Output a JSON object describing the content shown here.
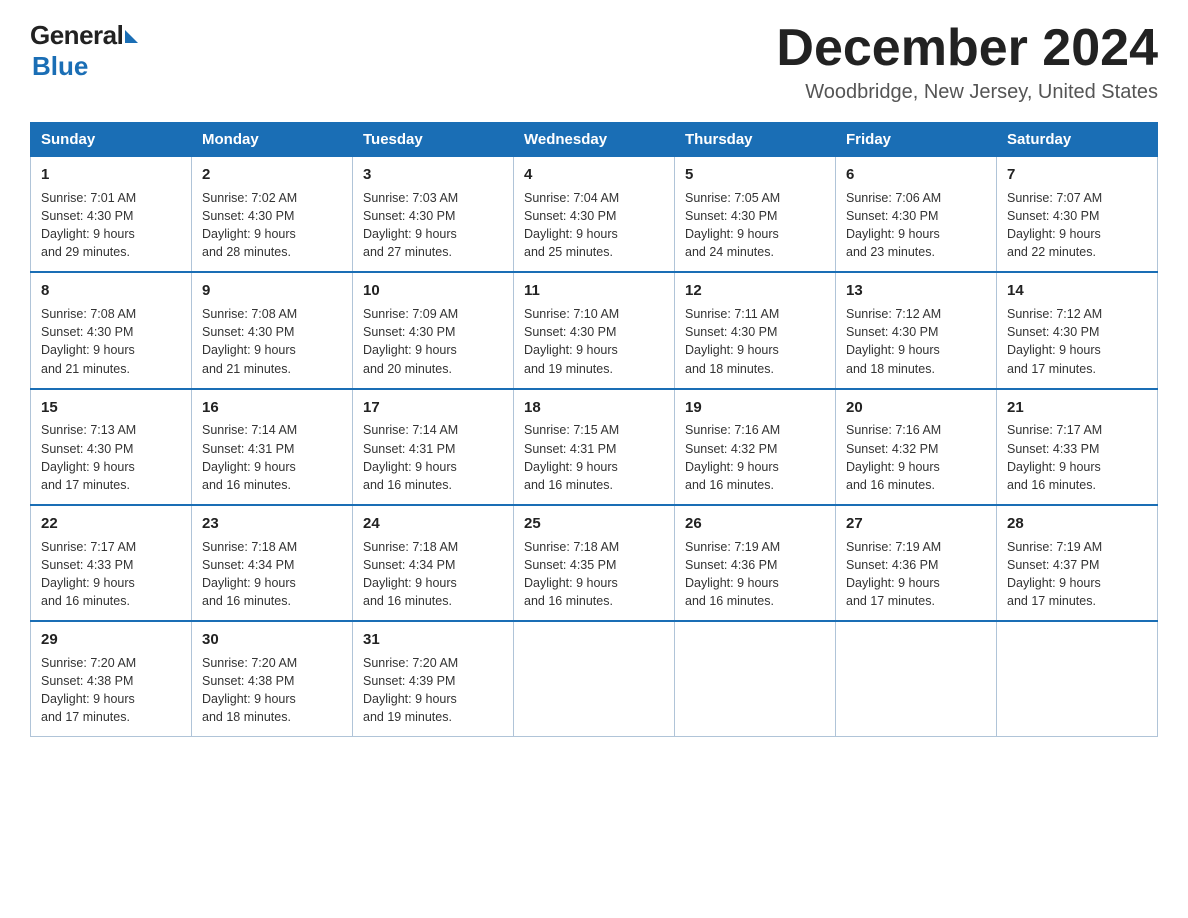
{
  "header": {
    "logo_general": "General",
    "logo_blue": "Blue",
    "month_title": "December 2024",
    "location": "Woodbridge, New Jersey, United States"
  },
  "days_of_week": [
    "Sunday",
    "Monday",
    "Tuesday",
    "Wednesday",
    "Thursday",
    "Friday",
    "Saturday"
  ],
  "weeks": [
    [
      {
        "day": "1",
        "sunrise": "7:01 AM",
        "sunset": "4:30 PM",
        "daylight": "9 hours and 29 minutes."
      },
      {
        "day": "2",
        "sunrise": "7:02 AM",
        "sunset": "4:30 PM",
        "daylight": "9 hours and 28 minutes."
      },
      {
        "day": "3",
        "sunrise": "7:03 AM",
        "sunset": "4:30 PM",
        "daylight": "9 hours and 27 minutes."
      },
      {
        "day": "4",
        "sunrise": "7:04 AM",
        "sunset": "4:30 PM",
        "daylight": "9 hours and 25 minutes."
      },
      {
        "day": "5",
        "sunrise": "7:05 AM",
        "sunset": "4:30 PM",
        "daylight": "9 hours and 24 minutes."
      },
      {
        "day": "6",
        "sunrise": "7:06 AM",
        "sunset": "4:30 PM",
        "daylight": "9 hours and 23 minutes."
      },
      {
        "day": "7",
        "sunrise": "7:07 AM",
        "sunset": "4:30 PM",
        "daylight": "9 hours and 22 minutes."
      }
    ],
    [
      {
        "day": "8",
        "sunrise": "7:08 AM",
        "sunset": "4:30 PM",
        "daylight": "9 hours and 21 minutes."
      },
      {
        "day": "9",
        "sunrise": "7:08 AM",
        "sunset": "4:30 PM",
        "daylight": "9 hours and 21 minutes."
      },
      {
        "day": "10",
        "sunrise": "7:09 AM",
        "sunset": "4:30 PM",
        "daylight": "9 hours and 20 minutes."
      },
      {
        "day": "11",
        "sunrise": "7:10 AM",
        "sunset": "4:30 PM",
        "daylight": "9 hours and 19 minutes."
      },
      {
        "day": "12",
        "sunrise": "7:11 AM",
        "sunset": "4:30 PM",
        "daylight": "9 hours and 18 minutes."
      },
      {
        "day": "13",
        "sunrise": "7:12 AM",
        "sunset": "4:30 PM",
        "daylight": "9 hours and 18 minutes."
      },
      {
        "day": "14",
        "sunrise": "7:12 AM",
        "sunset": "4:30 PM",
        "daylight": "9 hours and 17 minutes."
      }
    ],
    [
      {
        "day": "15",
        "sunrise": "7:13 AM",
        "sunset": "4:30 PM",
        "daylight": "9 hours and 17 minutes."
      },
      {
        "day": "16",
        "sunrise": "7:14 AM",
        "sunset": "4:31 PM",
        "daylight": "9 hours and 16 minutes."
      },
      {
        "day": "17",
        "sunrise": "7:14 AM",
        "sunset": "4:31 PM",
        "daylight": "9 hours and 16 minutes."
      },
      {
        "day": "18",
        "sunrise": "7:15 AM",
        "sunset": "4:31 PM",
        "daylight": "9 hours and 16 minutes."
      },
      {
        "day": "19",
        "sunrise": "7:16 AM",
        "sunset": "4:32 PM",
        "daylight": "9 hours and 16 minutes."
      },
      {
        "day": "20",
        "sunrise": "7:16 AM",
        "sunset": "4:32 PM",
        "daylight": "9 hours and 16 minutes."
      },
      {
        "day": "21",
        "sunrise": "7:17 AM",
        "sunset": "4:33 PM",
        "daylight": "9 hours and 16 minutes."
      }
    ],
    [
      {
        "day": "22",
        "sunrise": "7:17 AM",
        "sunset": "4:33 PM",
        "daylight": "9 hours and 16 minutes."
      },
      {
        "day": "23",
        "sunrise": "7:18 AM",
        "sunset": "4:34 PM",
        "daylight": "9 hours and 16 minutes."
      },
      {
        "day": "24",
        "sunrise": "7:18 AM",
        "sunset": "4:34 PM",
        "daylight": "9 hours and 16 minutes."
      },
      {
        "day": "25",
        "sunrise": "7:18 AM",
        "sunset": "4:35 PM",
        "daylight": "9 hours and 16 minutes."
      },
      {
        "day": "26",
        "sunrise": "7:19 AM",
        "sunset": "4:36 PM",
        "daylight": "9 hours and 16 minutes."
      },
      {
        "day": "27",
        "sunrise": "7:19 AM",
        "sunset": "4:36 PM",
        "daylight": "9 hours and 17 minutes."
      },
      {
        "day": "28",
        "sunrise": "7:19 AM",
        "sunset": "4:37 PM",
        "daylight": "9 hours and 17 minutes."
      }
    ],
    [
      {
        "day": "29",
        "sunrise": "7:20 AM",
        "sunset": "4:38 PM",
        "daylight": "9 hours and 17 minutes."
      },
      {
        "day": "30",
        "sunrise": "7:20 AM",
        "sunset": "4:38 PM",
        "daylight": "9 hours and 18 minutes."
      },
      {
        "day": "31",
        "sunrise": "7:20 AM",
        "sunset": "4:39 PM",
        "daylight": "9 hours and 19 minutes."
      },
      null,
      null,
      null,
      null
    ]
  ],
  "labels": {
    "sunrise": "Sunrise:",
    "sunset": "Sunset:",
    "daylight": "Daylight:"
  }
}
